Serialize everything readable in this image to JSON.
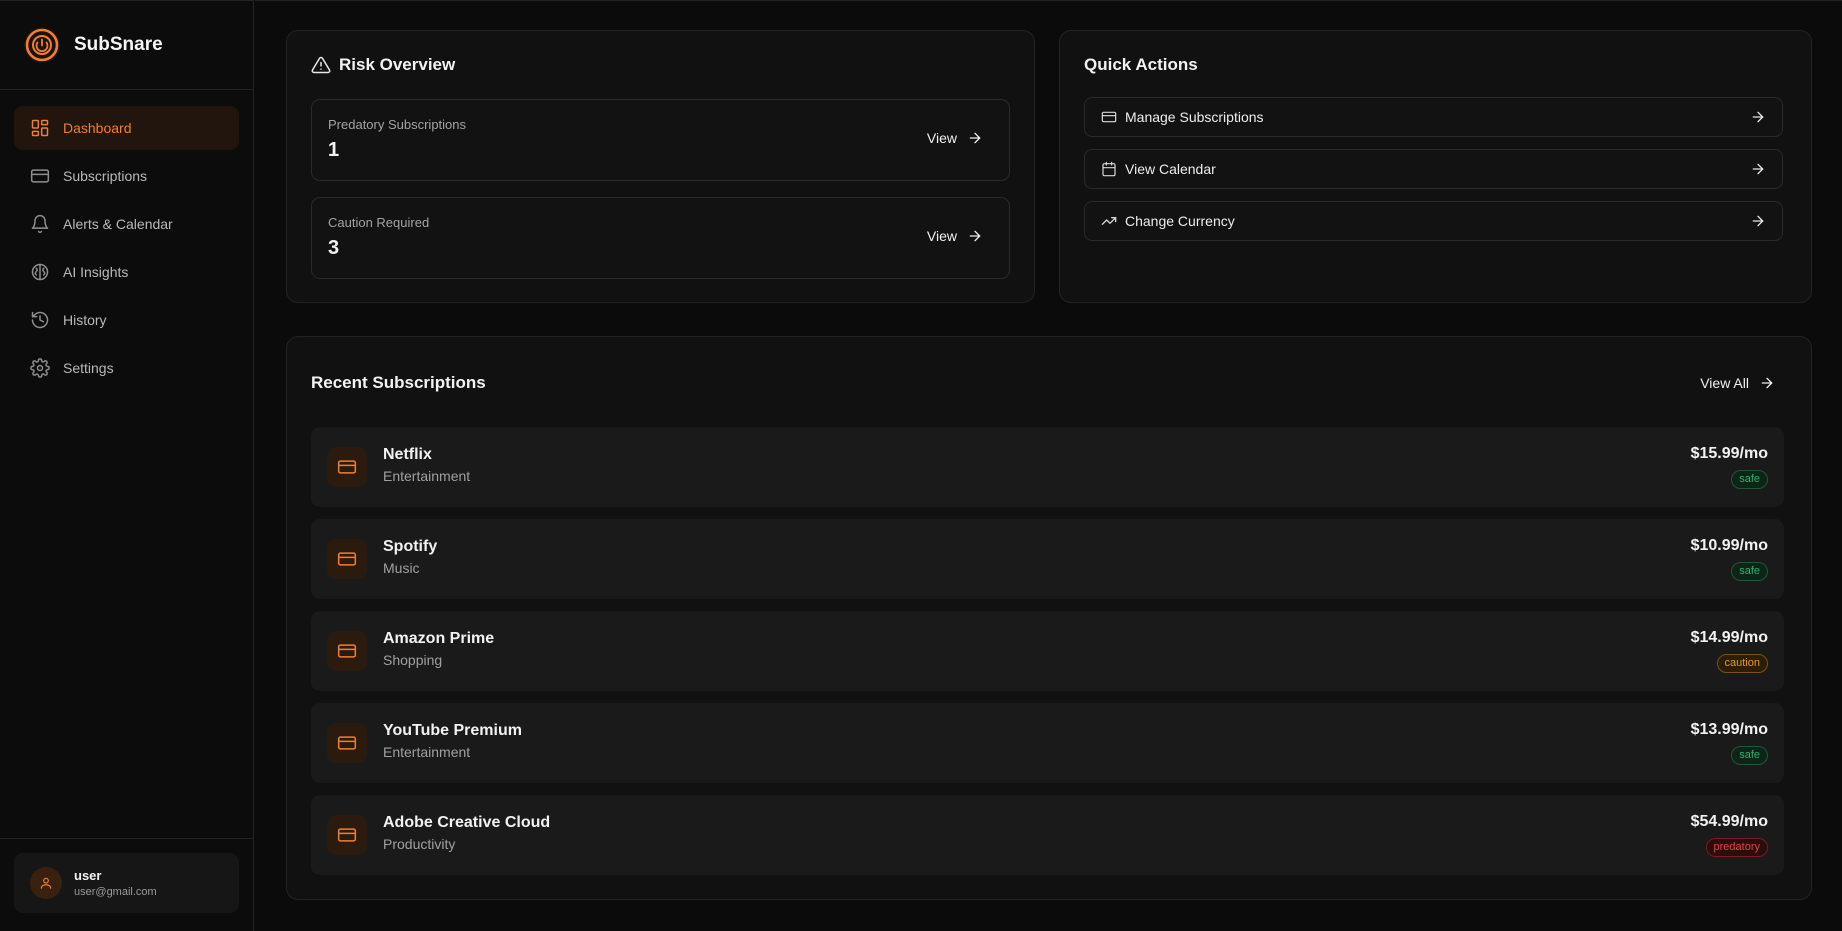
{
  "app": {
    "name": "SubSnare"
  },
  "sidebar": {
    "items": [
      {
        "label": "Dashboard",
        "icon": "dashboard-icon",
        "active": true
      },
      {
        "label": "Subscriptions",
        "icon": "credit-card-icon"
      },
      {
        "label": "Alerts & Calendar",
        "icon": "bell-icon"
      },
      {
        "label": "AI Insights",
        "icon": "brain-icon"
      },
      {
        "label": "History",
        "icon": "history-icon"
      },
      {
        "label": "Settings",
        "icon": "gear-icon"
      }
    ],
    "user": {
      "name": "user",
      "email": "user@gmail.com"
    }
  },
  "risk": {
    "title": "Risk Overview",
    "cards": [
      {
        "label": "Predatory Subscriptions",
        "count": "1",
        "action": "View"
      },
      {
        "label": "Caution Required",
        "count": "3",
        "action": "View"
      }
    ]
  },
  "quick_actions": {
    "title": "Quick Actions",
    "items": [
      {
        "label": "Manage Subscriptions",
        "icon": "credit-card-icon"
      },
      {
        "label": "View Calendar",
        "icon": "calendar-icon"
      },
      {
        "label": "Change Currency",
        "icon": "trending-up-icon"
      }
    ]
  },
  "recent": {
    "title": "Recent Subscriptions",
    "view_all": "View All",
    "items": [
      {
        "name": "Netflix",
        "category": "Entertainment",
        "price": "$15.99/mo",
        "status": "safe"
      },
      {
        "name": "Spotify",
        "category": "Music",
        "price": "$10.99/mo",
        "status": "safe"
      },
      {
        "name": "Amazon Prime",
        "category": "Shopping",
        "price": "$14.99/mo",
        "status": "caution"
      },
      {
        "name": "YouTube Premium",
        "category": "Entertainment",
        "price": "$13.99/mo",
        "status": "safe"
      },
      {
        "name": "Adobe Creative Cloud",
        "category": "Productivity",
        "price": "$54.99/mo",
        "status": "predatory"
      }
    ]
  },
  "colors": {
    "accent": "#f07f2f",
    "safe": "#2fb067",
    "caution": "#e39a22",
    "predatory": "#e24242",
    "background": "#0b0b0b"
  }
}
